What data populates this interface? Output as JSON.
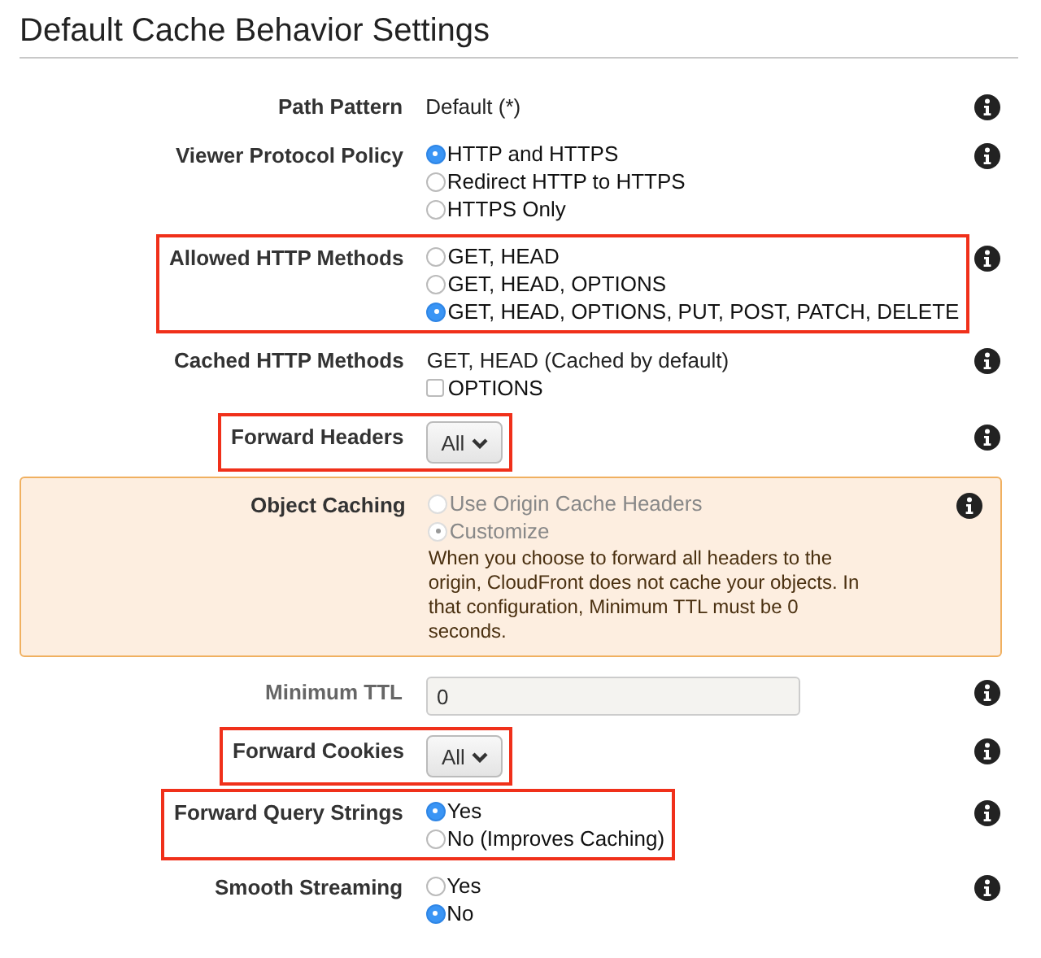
{
  "title": "Default Cache Behavior Settings",
  "rows": [
    {
      "label": "Path Pattern",
      "kind": "text",
      "highlighted": false,
      "warning": false,
      "disabled": false,
      "value": "Default (*)"
    },
    {
      "label": "Viewer Protocol Policy",
      "kind": "radios",
      "highlighted": false,
      "warning": false,
      "disabled": false,
      "options": [
        {
          "label": "HTTP and HTTPS",
          "selected": true,
          "disabled": false
        },
        {
          "label": "Redirect HTTP to HTTPS",
          "selected": false,
          "disabled": false
        },
        {
          "label": "HTTPS Only",
          "selected": false,
          "disabled": false
        }
      ]
    },
    {
      "label": "Allowed HTTP Methods",
      "kind": "radios",
      "highlighted": true,
      "warning": false,
      "disabled": false,
      "options": [
        {
          "label": "GET, HEAD",
          "selected": false,
          "disabled": false
        },
        {
          "label": "GET, HEAD, OPTIONS",
          "selected": false,
          "disabled": false
        },
        {
          "label": "GET, HEAD, OPTIONS, PUT, POST, PATCH, DELETE",
          "selected": true,
          "disabled": false
        }
      ]
    },
    {
      "label": "Cached HTTP Methods",
      "kind": "checkbox",
      "highlighted": false,
      "warning": false,
      "disabled": false,
      "value": "GET, HEAD (Cached by default)",
      "options": [
        {
          "label": "OPTIONS",
          "checked": false
        }
      ]
    },
    {
      "label": "Forward Headers",
      "kind": "select",
      "highlighted": true,
      "warning": false,
      "disabled": false,
      "value": "All"
    },
    {
      "label": "Object Caching",
      "kind": "radios",
      "highlighted": false,
      "warning": true,
      "disabled": false,
      "options": [
        {
          "label": "Use Origin Cache Headers",
          "selected": false,
          "disabled": true
        },
        {
          "label": "Customize",
          "selected": true,
          "disabled": true
        }
      ],
      "note": "When you choose to forward all headers to the origin, CloudFront does not cache your objects. In that configuration, Minimum TTL must be 0 seconds."
    },
    {
      "label": "Minimum TTL",
      "kind": "input",
      "highlighted": false,
      "warning": false,
      "disabled": true,
      "value": "0"
    },
    {
      "label": "Forward Cookies",
      "kind": "select",
      "highlighted": true,
      "warning": false,
      "disabled": false,
      "value": "All"
    },
    {
      "label": "Forward Query Strings",
      "kind": "radios",
      "highlighted": true,
      "warning": false,
      "disabled": false,
      "options": [
        {
          "label": "Yes",
          "selected": true,
          "disabled": false
        },
        {
          "label": "No (Improves Caching)",
          "selected": false,
          "disabled": false
        }
      ]
    },
    {
      "label": "Smooth Streaming",
      "kind": "radios",
      "highlighted": false,
      "warning": false,
      "disabled": false,
      "options": [
        {
          "label": "Yes",
          "selected": false,
          "disabled": false
        },
        {
          "label": "No",
          "selected": true,
          "disabled": false
        }
      ]
    }
  ]
}
